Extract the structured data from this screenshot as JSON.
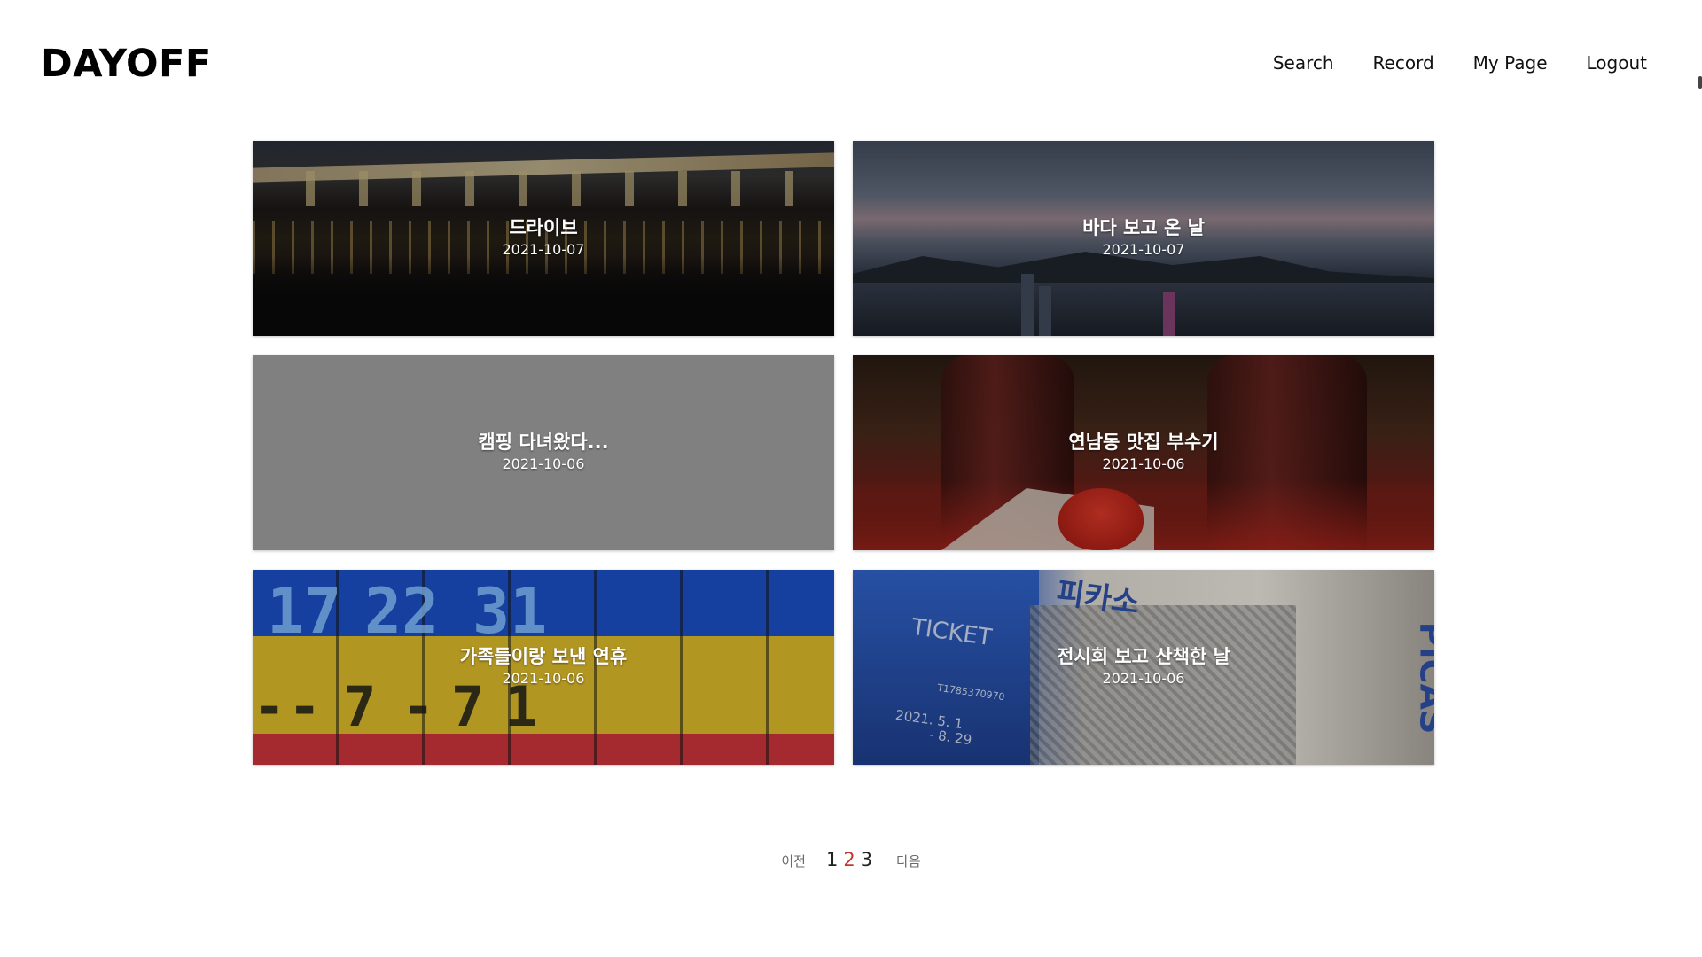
{
  "header": {
    "logo": "DAYOFF",
    "nav": [
      {
        "label": "Search"
      },
      {
        "label": "Record"
      },
      {
        "label": "My Page"
      },
      {
        "label": "Logout"
      }
    ]
  },
  "cards": [
    {
      "title": "드라이브",
      "date": "2021-10-07",
      "image": "night-bridge-photo"
    },
    {
      "title": "바다 보고 온 날",
      "date": "2021-10-07",
      "image": "sea-sunset-photo"
    },
    {
      "title": "캠핑 다녀왔다...",
      "date": "2021-10-06",
      "image": "none"
    },
    {
      "title": "연남동 맛집 부수기",
      "date": "2021-10-06",
      "image": "dessert-photo"
    },
    {
      "title": "가족들이랑 보낸 연휴",
      "date": "2021-10-06",
      "image": "scoreboard-photo"
    },
    {
      "title": "전시회 보고 산책한 날",
      "date": "2021-10-06",
      "image": "exhibition-ticket-photo"
    }
  ],
  "photo_text": {
    "scoreboard_top": [
      "17",
      "22",
      "31"
    ],
    "scoreboard_bottom": [
      "-",
      "-",
      "7",
      "-",
      "7",
      "1"
    ],
    "ticket": {
      "word": "TICKET",
      "picasso_kr": "피카소",
      "picasso_en": "PICAS",
      "dates": "2021. 5. 1",
      "dates2": "- 8. 29",
      "code": "T1785370970"
    }
  },
  "pagination": {
    "prev": "이전",
    "pages": [
      "1",
      "2",
      "3"
    ],
    "current": "2",
    "next": "다음"
  },
  "colors": {
    "active_page": "#c0392b",
    "placeholder_card": "#808080"
  }
}
